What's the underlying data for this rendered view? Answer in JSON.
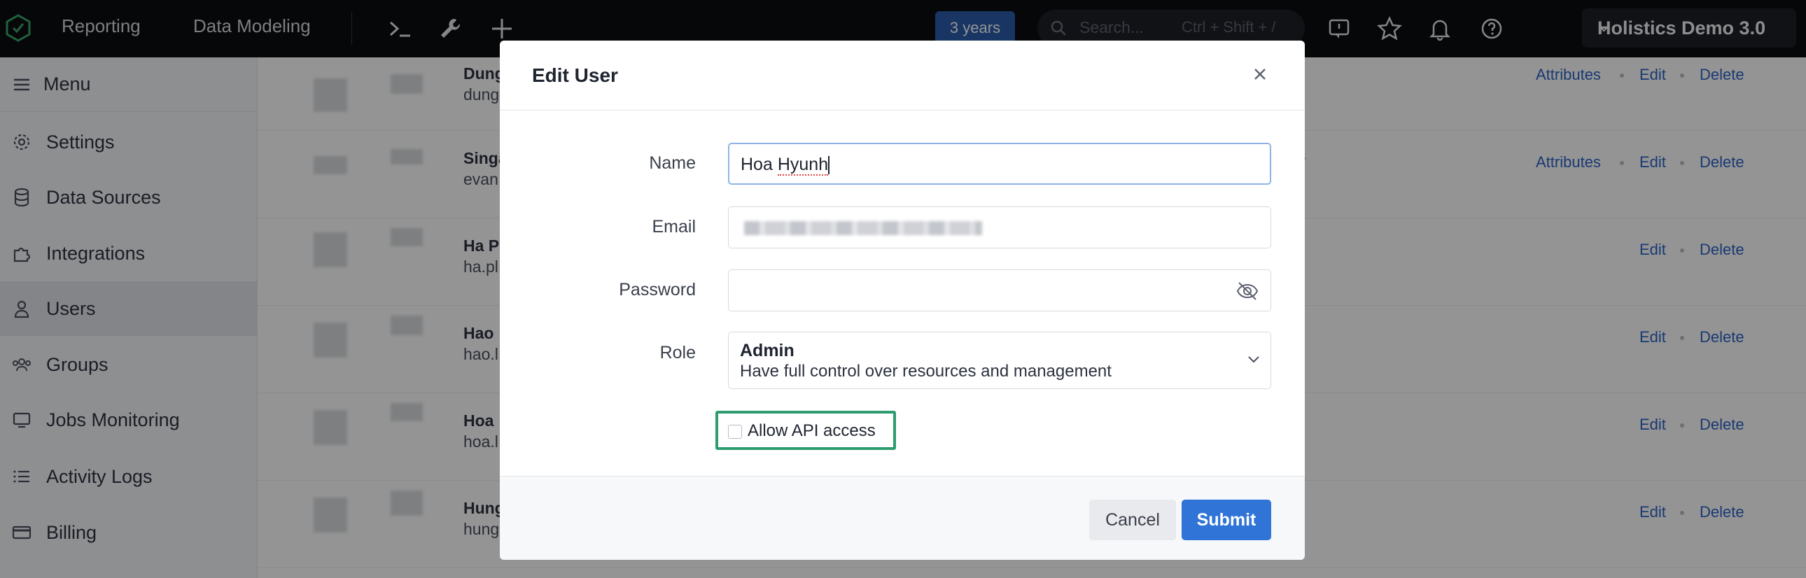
{
  "topbar": {
    "nav": [
      "Reporting",
      "Data Modeling"
    ],
    "years_badge": "3 years",
    "search_placeholder": "Search...",
    "search_shortcut": "Ctrl + Shift + /",
    "workspace": "Holistics Demo 3.0",
    "icons": [
      "terminal-icon",
      "wrench-icon",
      "plus-icon",
      "feedback-icon",
      "star-icon",
      "bell-icon",
      "help-icon"
    ]
  },
  "sidebar": {
    "menu_label": "Menu",
    "items": [
      {
        "label": "Settings",
        "icon": "gear-icon"
      },
      {
        "label": "Data Sources",
        "icon": "database-icon"
      },
      {
        "label": "Integrations",
        "icon": "puzzle-icon"
      },
      {
        "label": "Users",
        "icon": "user-icon",
        "active": true
      },
      {
        "label": "Groups",
        "icon": "group-icon"
      },
      {
        "label": "Jobs Monitoring",
        "icon": "monitor-icon"
      },
      {
        "label": "Activity Logs",
        "icon": "list-icon"
      },
      {
        "label": "Billing",
        "icon": "card-icon"
      }
    ]
  },
  "table": {
    "rows": [
      {
        "name": "Dung",
        "email": "dung",
        "actions": [
          "Attributes",
          "Edit",
          "Delete"
        ]
      },
      {
        "name": "Singa",
        "email": "evan",
        "actions": [
          "Attributes",
          "Edit",
          "Delete"
        ]
      },
      {
        "name": "Ha P",
        "email": "ha.pl",
        "actions": [
          "Edit",
          "Delete"
        ]
      },
      {
        "name": "Hao",
        "email": "hao.l",
        "actions": [
          "Edit",
          "Delete"
        ]
      },
      {
        "name": "Hoa",
        "email": "hoa.l",
        "actions": [
          "Edit",
          "Delete"
        ]
      },
      {
        "name": "Hung",
        "email": "hung",
        "actions": [
          "Edit",
          "Delete"
        ]
      }
    ],
    "fragment_s": "s"
  },
  "modal": {
    "title": "Edit User",
    "name_label": "Name",
    "name_value": "Hoa Hyunh",
    "email_label": "Email",
    "password_label": "Password",
    "role_label": "Role",
    "role_name": "Admin",
    "role_desc": "Have full control over resources and management",
    "api_label": "Allow API access",
    "api_checked": false,
    "cancel": "Cancel",
    "submit": "Submit"
  },
  "colors": {
    "accent": "#2f74d6",
    "highlight": "#2d9c6f",
    "topbar": "#0c0d10"
  }
}
